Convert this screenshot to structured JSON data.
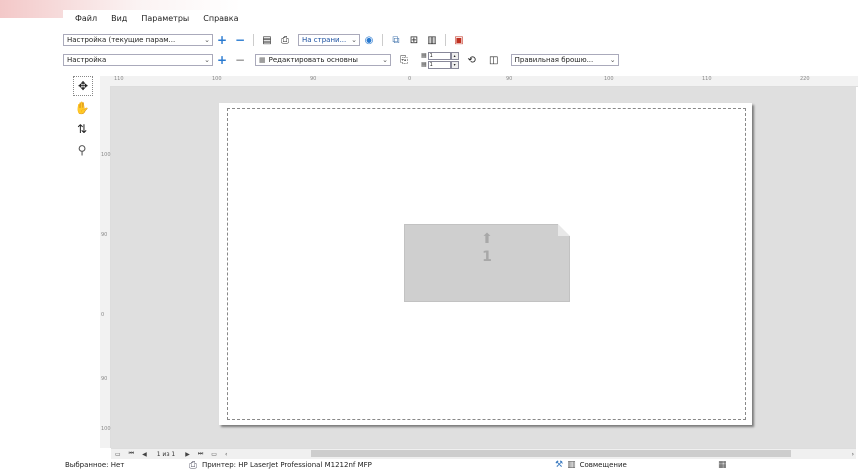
{
  "menu": {
    "file": "Файл",
    "view": "Вид",
    "params": "Параметры",
    "help": "Справка"
  },
  "toolbar1": {
    "preset_combo": "Настройка (текущие парам...",
    "page_combo": "На страни..."
  },
  "toolbar2": {
    "setup_combo": "Настройка",
    "edit_base_combo": "Редактировать основны",
    "spin_rows": "1",
    "spin_cols": "1",
    "brochure_combo": "Правильная брошю..."
  },
  "ruler_top": [
    "110",
    "100",
    "90",
    "0",
    "90",
    "100",
    "110",
    "220"
  ],
  "ruler_left": [
    "100",
    "90",
    "0",
    "90",
    "100"
  ],
  "sheet": {
    "page_number": "1"
  },
  "hscroll": {
    "pager": "1 из 1"
  },
  "status": {
    "selected": "Выбранное: Нет",
    "printer": "Принтер: HP LaserJet Professional M1212nf MFP",
    "alignment": "Совмещение"
  }
}
